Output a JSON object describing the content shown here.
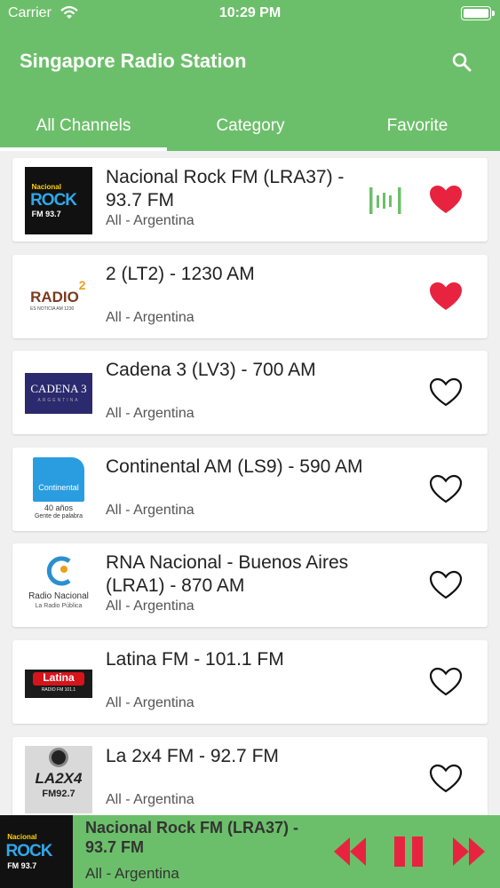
{
  "status": {
    "carrier": "Carrier",
    "time": "10:29 PM"
  },
  "app": {
    "title": "Singapore Radio Station"
  },
  "tabs": [
    "All Channels",
    "Category",
    "Favorite"
  ],
  "colors": {
    "accent": "#6cbf6a",
    "heart_filled": "#e8233f",
    "eq": "#6cbf6a"
  },
  "stations": [
    {
      "name": "Nacional Rock FM (LRA37) - 93.7 FM",
      "sub": "All - Argentina",
      "favorite": true,
      "playing": true,
      "logo": {
        "kind": "nacional-rock",
        "line1": "Nacional",
        "line2": "ROCK",
        "line3": "FM 93.7"
      }
    },
    {
      "name": "2 (LT2) - 1230 AM",
      "sub": "All - Argentina",
      "favorite": true,
      "playing": false,
      "logo": {
        "kind": "radio2",
        "line1": "RADIO",
        "line2": "2",
        "line3": "ES NOTICIA  AM 1230"
      }
    },
    {
      "name": "Cadena 3 (LV3) - 700 AM",
      "sub": "All - Argentina",
      "favorite": false,
      "playing": false,
      "logo": {
        "kind": "cadena3",
        "line1": "CADENA 3",
        "line2": "ARGENTINA"
      }
    },
    {
      "name": "Continental AM (LS9) - 590 AM",
      "sub": "All - Argentina",
      "favorite": false,
      "playing": false,
      "logo": {
        "kind": "continental",
        "line1": "Continental",
        "line2": "40 años",
        "line3": "Gente de palabra"
      }
    },
    {
      "name": "RNA  Nacional - Buenos Aires (LRA1) - 870 AM",
      "sub": "All - Argentina",
      "favorite": false,
      "playing": false,
      "logo": {
        "kind": "radio-nacional",
        "line1": "Radio Nacional",
        "line2": "La Radio Pública"
      }
    },
    {
      "name": "Latina FM - 101.1 FM",
      "sub": "All - Argentina",
      "favorite": false,
      "playing": false,
      "logo": {
        "kind": "latina",
        "line1": "Latina",
        "line2": "RADIO FM 101.1"
      }
    },
    {
      "name": "La 2x4 FM - 92.7 FM",
      "sub": "All - Argentina",
      "favorite": false,
      "playing": false,
      "logo": {
        "kind": "la2x4",
        "line1": "LA2X4",
        "line2": "FM92.7"
      }
    }
  ],
  "player": {
    "title": "Nacional Rock FM (LRA37) - 93.7 FM",
    "sub": "All - Argentina",
    "logo": {
      "line1": "Nacional",
      "line2": "ROCK",
      "line3": "FM 93.7"
    },
    "controls": [
      "rewind-icon",
      "pause-icon",
      "fast-forward-icon"
    ]
  }
}
